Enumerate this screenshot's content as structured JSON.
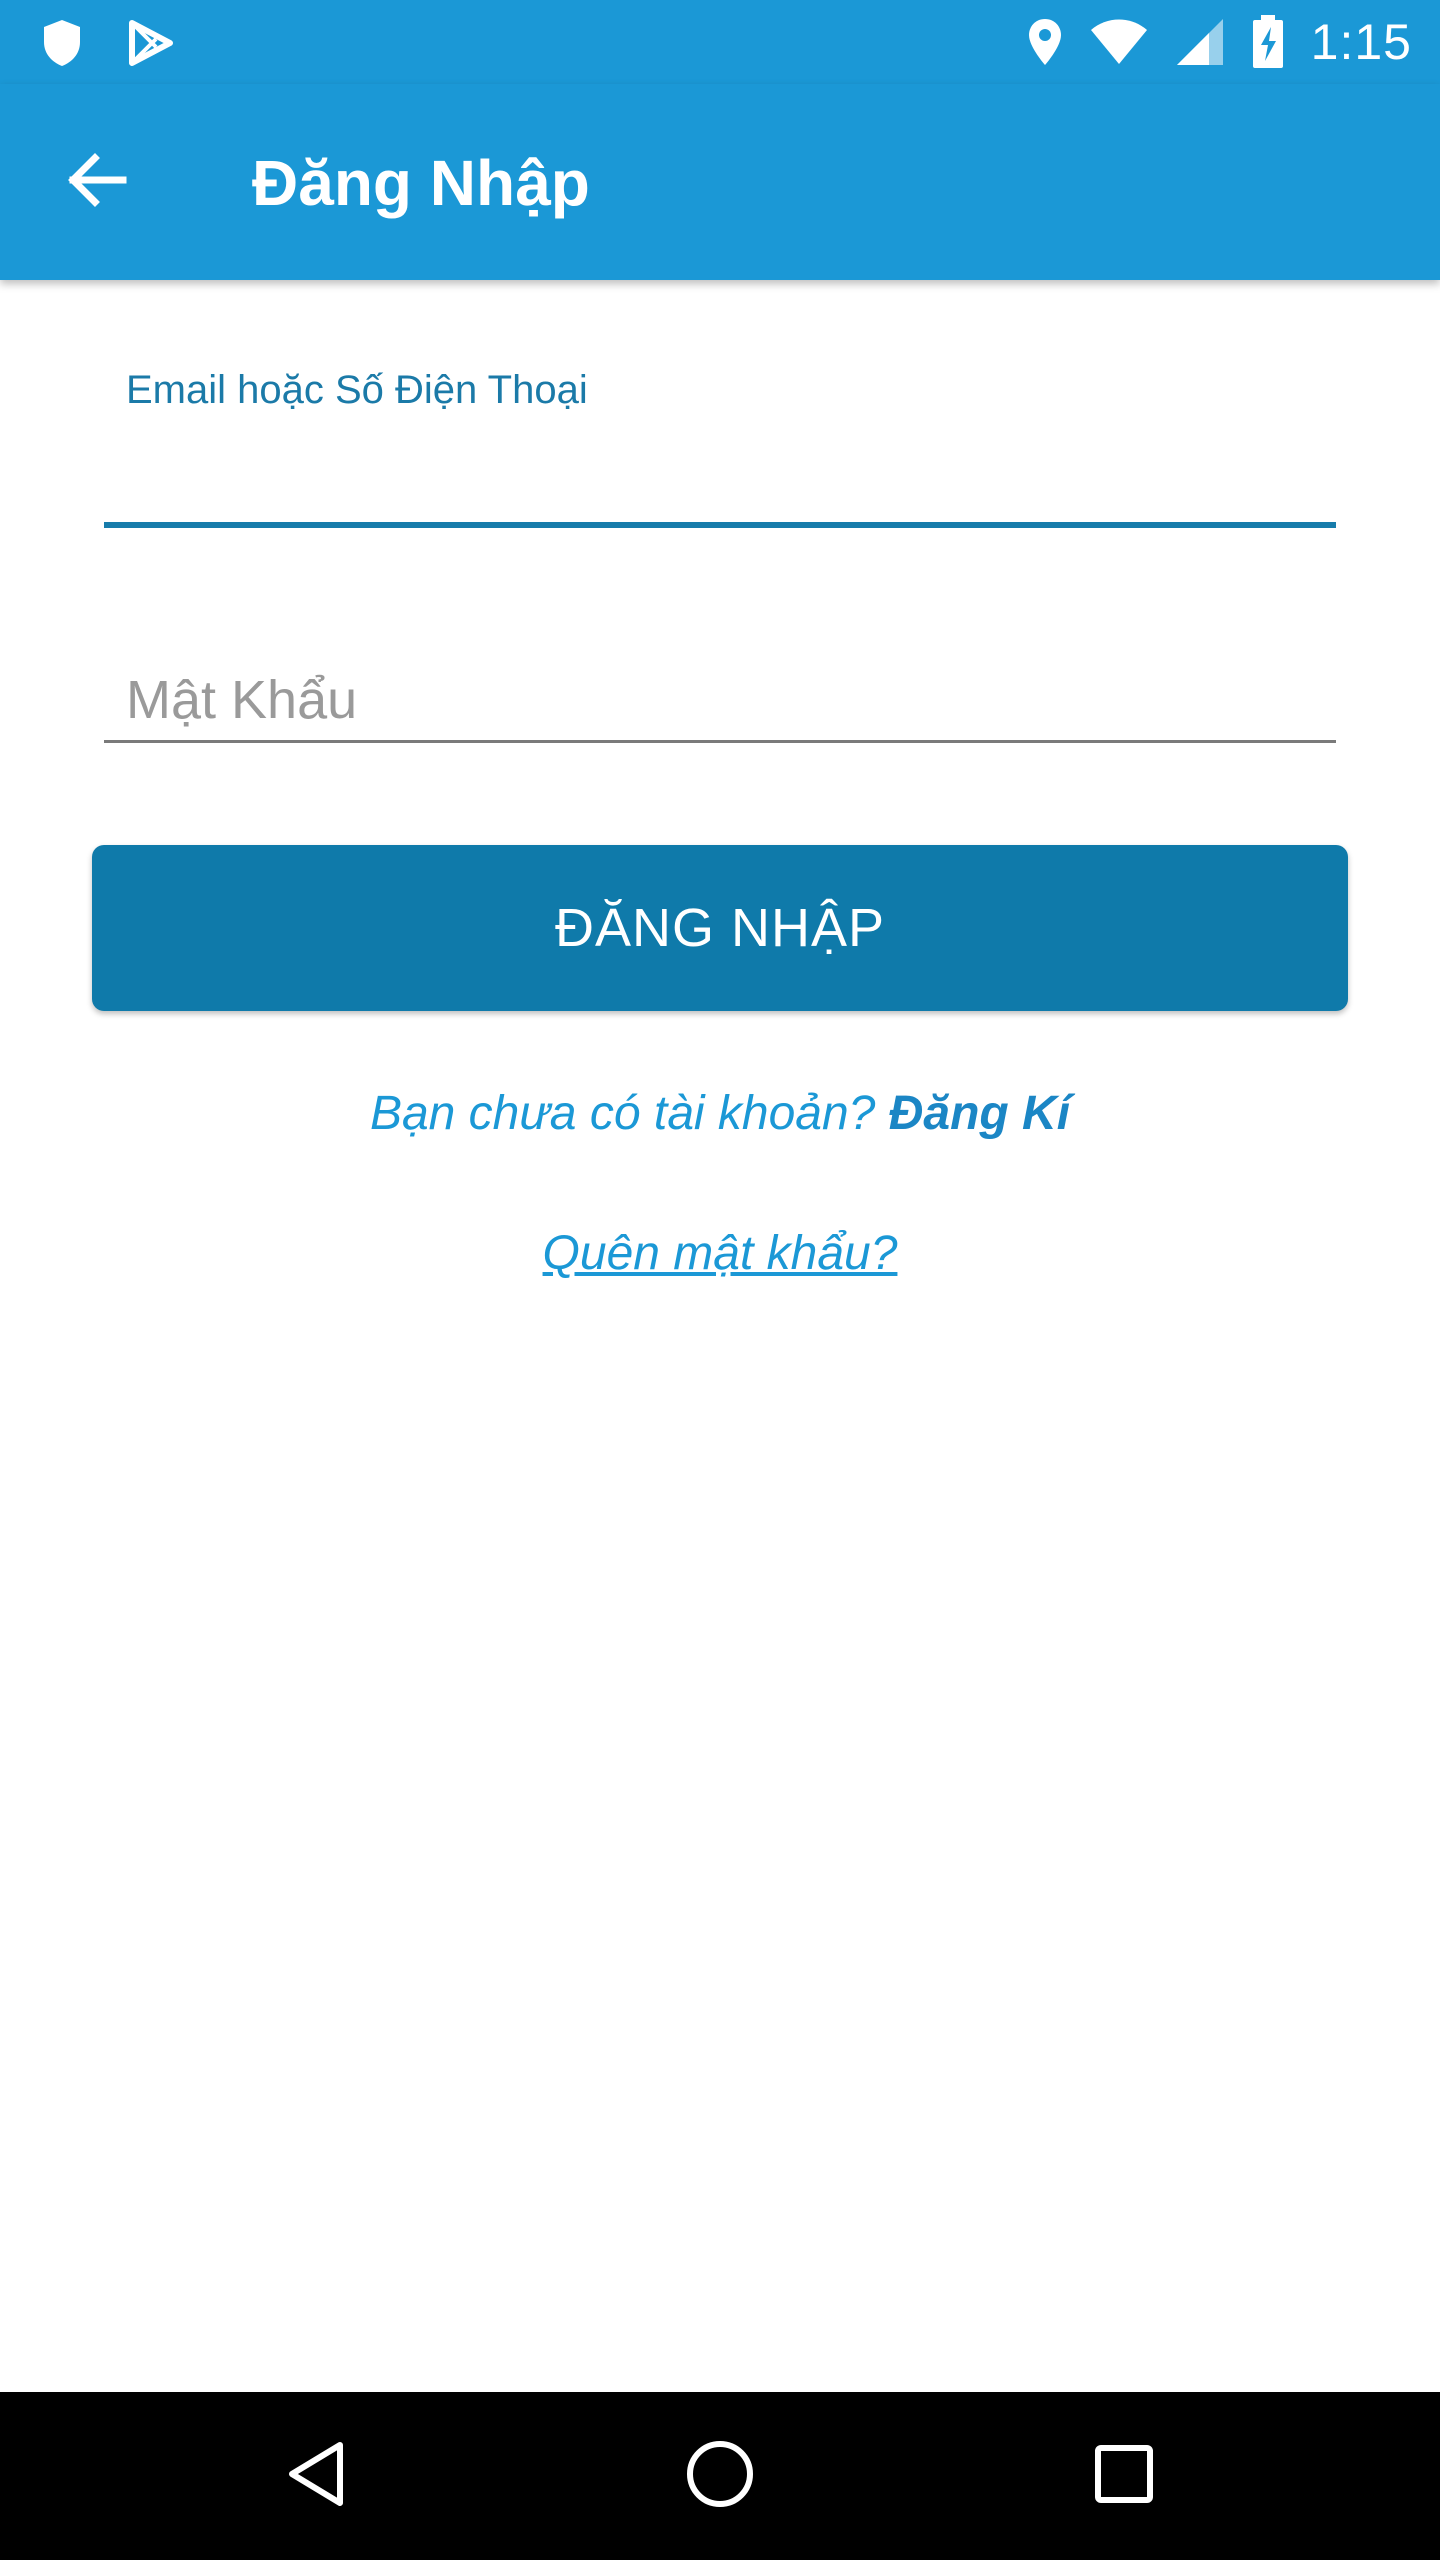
{
  "status_bar": {
    "time": "1:15",
    "icons": [
      "shield-icon",
      "play-store-icon",
      "location-icon",
      "wifi-icon",
      "signal-icon",
      "battery-charging-icon"
    ]
  },
  "app_bar": {
    "title": "Đăng Nhập",
    "back_icon": "arrow-left-icon"
  },
  "form": {
    "email_label": "Email hoặc Số Điện Thoại",
    "email_value": "",
    "password_placeholder": "Mật Khẩu",
    "login_button": "ĐĂNG NHẬP"
  },
  "links": {
    "register_prompt": "Bạn chưa có tài khoản? ",
    "register_link": "Đăng Kí",
    "forgot_password": "Quên mật khẩu?"
  },
  "nav_bar": {
    "icons": [
      "back-triangle-icon",
      "home-circle-icon",
      "recents-square-icon"
    ]
  },
  "colors": {
    "primary": "#1b98d6",
    "button": "#0f7aaa",
    "input_accent": "#177cab",
    "nav_bar": "#000000"
  }
}
